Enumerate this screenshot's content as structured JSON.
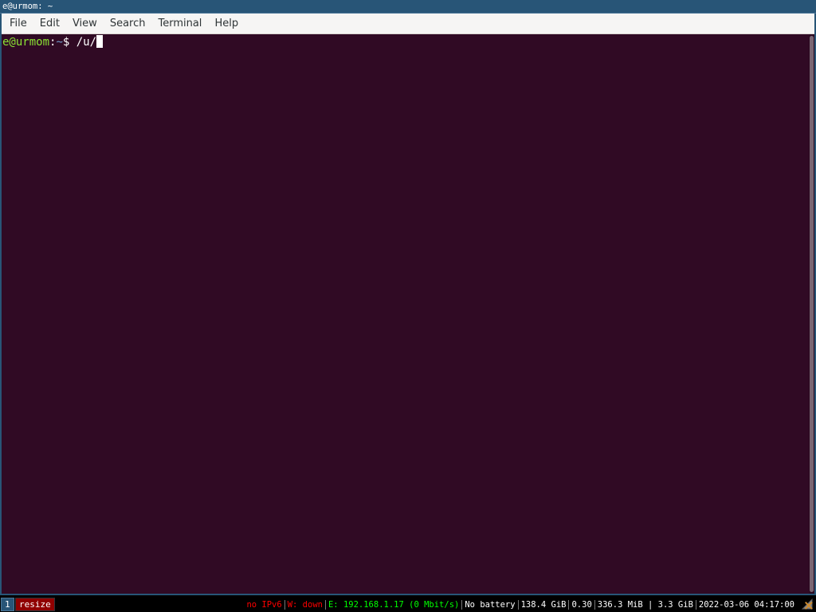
{
  "window": {
    "title": "e@urmom: ~"
  },
  "menubar": {
    "items": [
      "File",
      "Edit",
      "View",
      "Search",
      "Terminal",
      "Help"
    ]
  },
  "terminal": {
    "prompt_user": "e@urmom",
    "prompt_colon": ":",
    "prompt_path": "~",
    "prompt_symbol": "$ ",
    "input": "/u/"
  },
  "i3bar": {
    "workspace": "1",
    "mode": "resize",
    "status": {
      "ipv6": "no IPv6",
      "wireless": "W: down",
      "ethernet": "E: 192.168.1.17 (0 Mbit/s)",
      "battery": "No battery",
      "disk": "138.4 GiB",
      "load": "0.30",
      "memory": "336.3 MiB | 3.3 GiB",
      "datetime": "2022-03-06 04:17:00"
    },
    "tray_icon": "network-disconnected-icon"
  },
  "colors": {
    "terminal_bg": "#300a24",
    "focused_border": "#285577",
    "prompt_user": "#8ae234",
    "prompt_path": "#729fcf",
    "status_bad": "#ff0000",
    "status_good": "#00ff00"
  }
}
